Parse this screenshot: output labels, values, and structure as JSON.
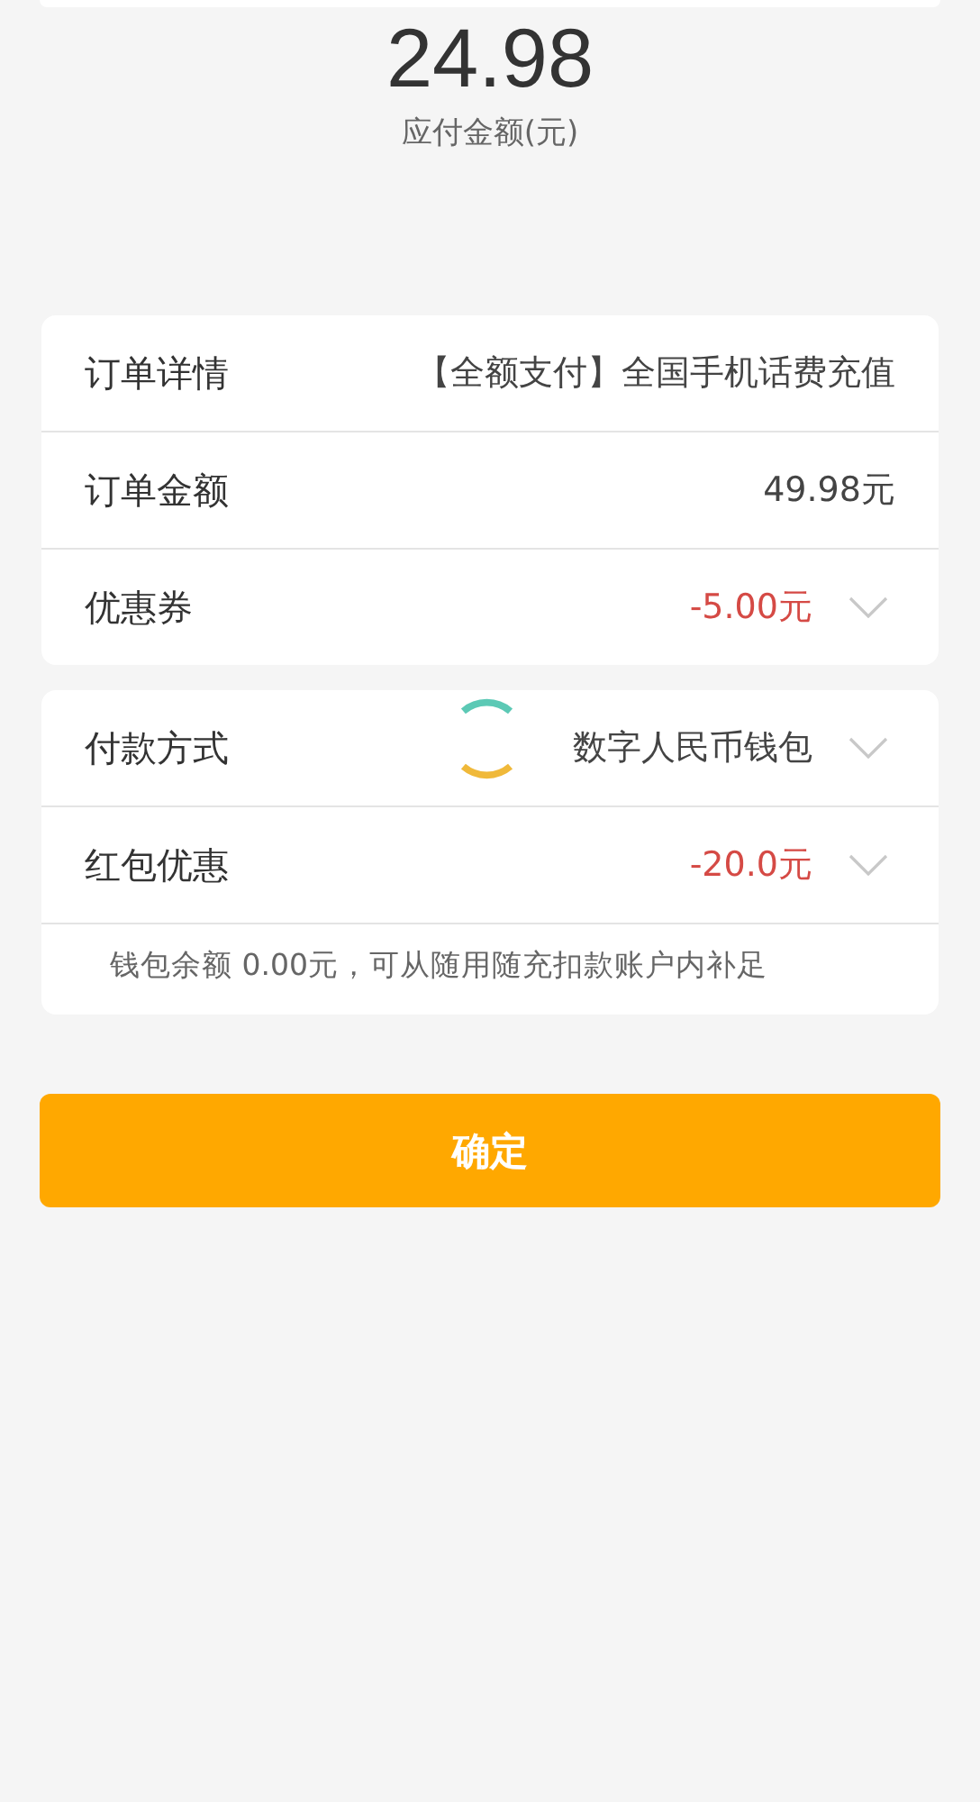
{
  "amount": {
    "value": "24.98",
    "label": "应付金额(元)"
  },
  "order_card": {
    "rows": [
      {
        "label": "订单详情",
        "value": "【全额支付】全国手机话费充值",
        "kind": "plain",
        "expandable": false
      },
      {
        "label": "订单金额",
        "value": "49.98元",
        "kind": "plain",
        "expandable": false
      },
      {
        "label": "优惠券",
        "value": "-5.00元",
        "kind": "discount",
        "expandable": true
      }
    ]
  },
  "payment_card": {
    "rows": [
      {
        "label": "付款方式",
        "value": "数字人民币钱包",
        "kind": "plain",
        "expandable": true
      },
      {
        "label": "红包优惠",
        "value": "-20.0元",
        "kind": "discount",
        "expandable": true
      }
    ],
    "note": "钱包余额  0.00元，可从随用随充扣款账户内补足"
  },
  "loading": true,
  "confirm_button": "确定"
}
